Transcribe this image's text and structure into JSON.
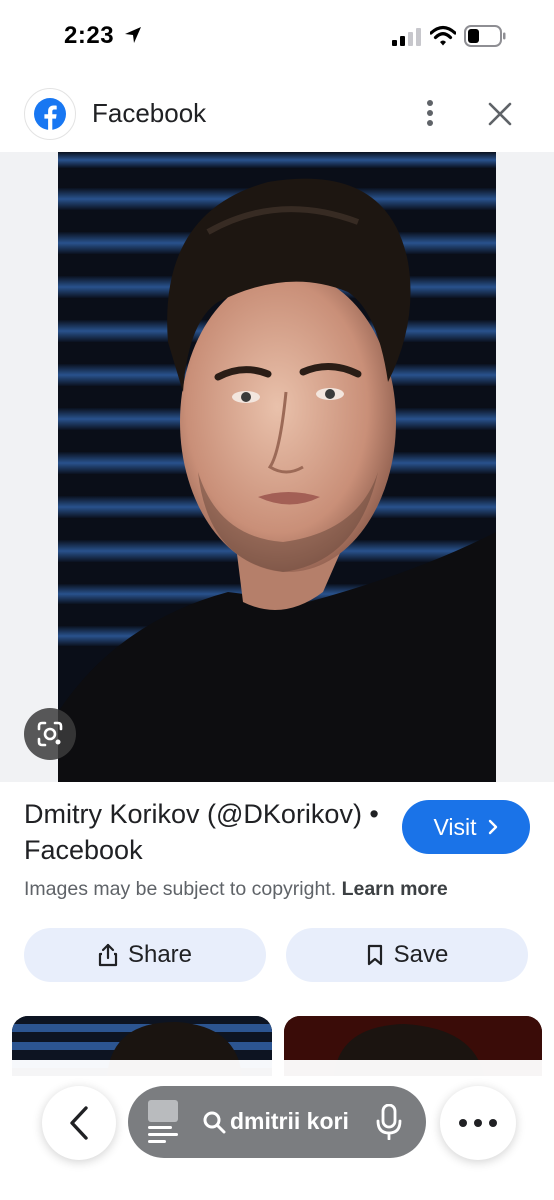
{
  "status_bar": {
    "time": "2:23",
    "icons": [
      "location-arrow-icon",
      "signal-icon",
      "wifi-icon",
      "battery-icon"
    ]
  },
  "source": {
    "name": "Facebook",
    "logo_icon": "facebook-logo-icon",
    "brand_color": "#1877f2"
  },
  "result": {
    "title": "Dmitry Korikov (@DKorikov) • Facebook",
    "visit_label": "Visit",
    "copyright_text": "Images may be subject to copyright.",
    "learn_more_label": "Learn more",
    "share_label": "Share",
    "save_label": "Save"
  },
  "bottom_bar": {
    "search_query": "dmitrii kori",
    "icons": [
      "back-icon",
      "tabs-icon",
      "search-icon",
      "mic-icon",
      "more-icon"
    ]
  },
  "colors": {
    "accent": "#1a73e8",
    "chip_bg": "#e8eefb",
    "image_bg": "#f1f2f4"
  }
}
